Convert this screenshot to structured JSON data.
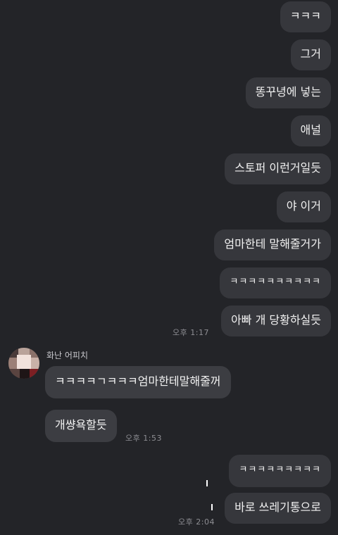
{
  "sent_group_1": [
    {
      "text": "ㅋㅋㅋ"
    },
    {
      "text": "그거"
    },
    {
      "text": "똥꾸녕에 넣는"
    },
    {
      "text": "애널"
    },
    {
      "text": "스토퍼 이런거일듯"
    },
    {
      "text": "야 이거"
    },
    {
      "text": "엄마한테 말해줄거가"
    },
    {
      "text": "ㅋㅋㅋㅋㅋㅋㅋㅋㅋㅋ"
    },
    {
      "text": "아빠 개 당황하실듯"
    }
  ],
  "sent_group_1_time": "오후 1:17",
  "received": {
    "sender": "화난 어피치",
    "messages": [
      {
        "text": "ㅋㅋㅋㅋㄱㅋㅋㅋ엄마한테말해줄꺼"
      },
      {
        "text": "개썅욕할듯"
      }
    ],
    "time": "오후 1:53"
  },
  "sent_group_2": [
    {
      "text": "ㅋㅋㅋㅋㅋㅋㅋㅋㅋ"
    },
    {
      "text": "바로 쓰레기통으로"
    }
  ],
  "sent_group_2_time": "오후 2:04",
  "colors": {
    "background": "#232428",
    "bubble_sent": "#36373c",
    "bubble_received": "#3c3d42",
    "text": "#f2f2f2",
    "timestamp": "#8e8e93"
  }
}
